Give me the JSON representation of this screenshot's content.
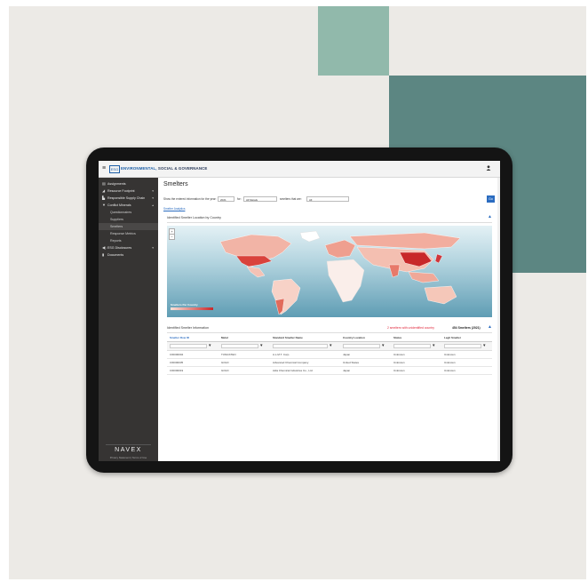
{
  "app": {
    "menu_icon": "≡",
    "logo_text": "ESG",
    "title_highlight": "ENVIRONMENTAL,",
    "title_rest": " SOCIAL & GOVERNANCE",
    "user_icon": "user-icon"
  },
  "sidebar": {
    "items": [
      {
        "icon": "▤",
        "label": "Assignments",
        "chevron": ""
      },
      {
        "icon": "◢",
        "label": "Resource Footprint",
        "chevron": "▾"
      },
      {
        "icon": "▙",
        "label": "Responsible Supply Chain",
        "chevron": "▾"
      },
      {
        "icon": "▼",
        "label": "Conflict Minerals",
        "chevron": "▴"
      },
      {
        "icon": "",
        "label": "Questionnaires",
        "chevron": ""
      },
      {
        "icon": "",
        "label": "Suppliers",
        "chevron": ""
      },
      {
        "icon": "",
        "label": "Smelters",
        "chevron": ""
      },
      {
        "icon": "",
        "label": "Response Metrics",
        "chevron": ""
      },
      {
        "icon": "",
        "label": "Reports",
        "chevron": ""
      },
      {
        "icon": "◀)",
        "label": "ESG Disclosures",
        "chevron": "▾"
      },
      {
        "icon": "▮",
        "label": "Documents",
        "chevron": ""
      }
    ],
    "footer_logo": "NAVEX",
    "footer_links": "Privacy Statement  |  Terms of Use"
  },
  "main": {
    "page_title": "Smelters",
    "filter": {
      "label1": "Show the entered information for the year:",
      "year": "2021",
      "label2": "for:",
      "metals": "All Metals",
      "label3": "smelters that are:",
      "status": "All",
      "go_label": "Go"
    },
    "link_text": "Smelter Analytics",
    "map_section_title": "Identified Smelter Location by Country",
    "map_legend_title": "Smelters Per Country",
    "zoom_in": "+",
    "zoom_out": "−",
    "info_section_title": "Identified Smelter Information",
    "unidentified_text": "2 smelters with unidentified country",
    "count_text": "454 Smelters (2021)",
    "table": {
      "columns": [
        "Smelter Row ID",
        "Metal",
        "Standard Smelter Name",
        "Country Location",
        "Status",
        "Legit Smelter"
      ],
      "rows": [
        [
          "CID000004",
          "TUNGSTEN",
          "A.L.M.T. Corp.",
          "Japan",
          "Unknown",
          "Unknown"
        ],
        [
          "CID000035",
          "GOLD",
          "Advanced Chemical Company",
          "United States",
          "Unknown",
          "Unknown"
        ],
        [
          "CID000019",
          "GOLD",
          "Aida Chemical Industries Co., Ltd.",
          "Japan",
          "Unknown",
          "Unknown"
        ]
      ]
    }
  },
  "colors": {
    "accent_blue": "#2b6cc0",
    "sidebar_bg": "#363433",
    "alert_red": "#e0263a",
    "map_high": "#c8282a",
    "map_low": "#fbe1d8"
  }
}
